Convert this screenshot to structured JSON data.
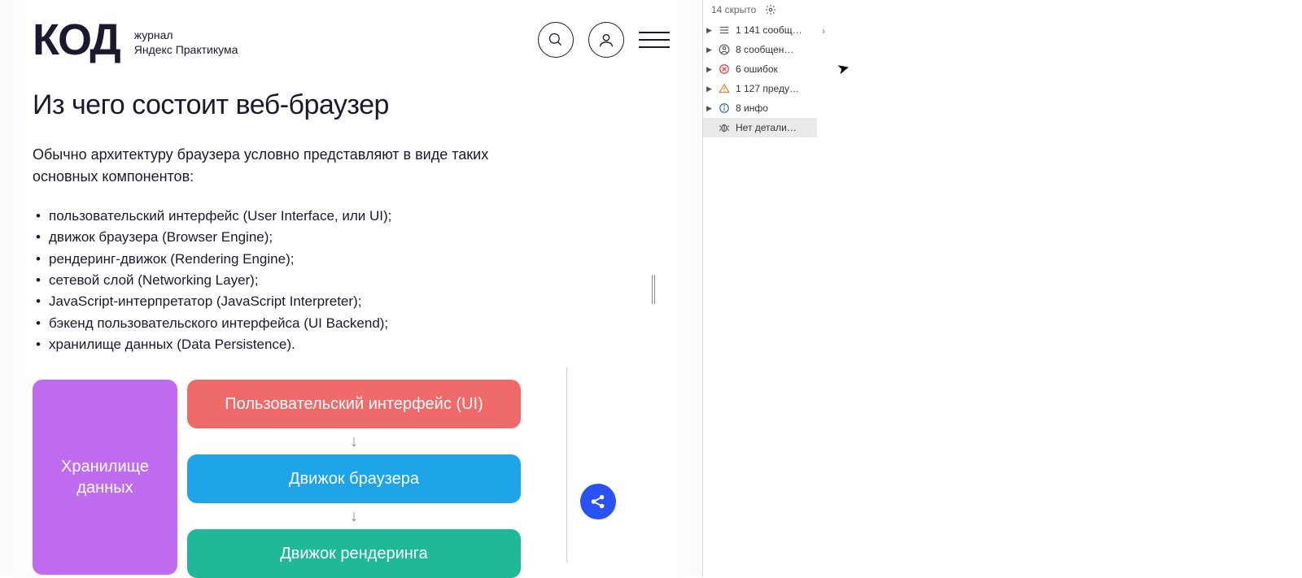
{
  "header": {
    "logo_text": "КОД",
    "logo_sub_line1": "журнал",
    "logo_sub_line2": "Яндекс Практикума"
  },
  "article": {
    "title": "Из чего состоит веб-браузер",
    "intro": "Обычно архитектуру браузера условно представляют в виде таких основных компонентов:",
    "components": [
      "пользовательский интерфейс (User Interface, или UI);",
      "движок браузера (Browser Engine);",
      "рендеринг-движок (Rendering Engine);",
      "сетевой слой (Networking Layer);",
      "JavaScript-интерпретатор (JavaScript Interpreter);",
      "бэкенд пользовательского интерфейса (UI Backend);",
      "хранилище данных (Data Persistence)."
    ],
    "diagram": {
      "storage": "Хранилище данных",
      "ui": "Пользовательский интерфейс (UI)",
      "engine": "Движок браузера",
      "render": "Движок рендеринга"
    }
  },
  "devtools": {
    "hidden_text": "14 скрыто",
    "rows": [
      {
        "label": "1 141 сообщ…"
      },
      {
        "label": "8 сообщен…"
      },
      {
        "label": "6 ошибок"
      },
      {
        "label": "1 127 преду…"
      },
      {
        "label": "8 инфо"
      },
      {
        "label": "Нет детали…"
      }
    ],
    "prompt": "›"
  }
}
